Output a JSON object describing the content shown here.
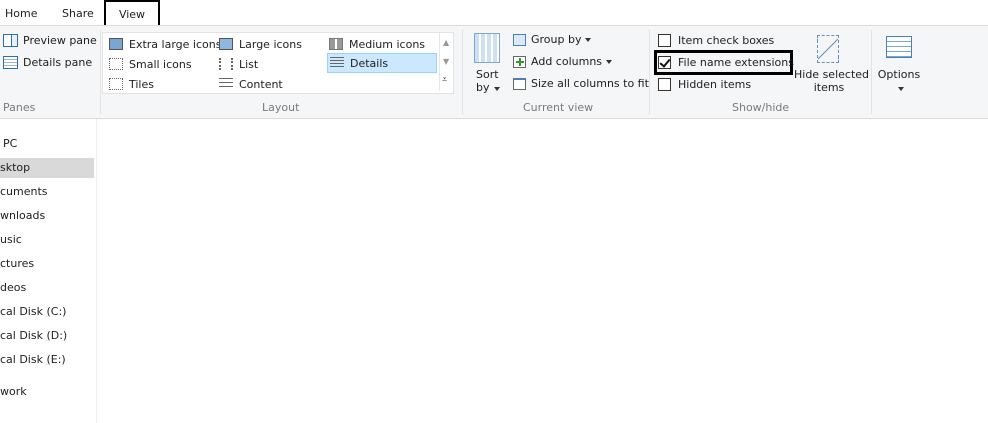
{
  "tabs": {
    "home": "Home",
    "share": "Share",
    "view": "View"
  },
  "panes": {
    "preview_pane": "Preview pane",
    "details_pane": "Details pane",
    "group_label": "Panes"
  },
  "layout": {
    "items": [
      "Extra large icons",
      "Large icons",
      "Medium icons",
      "Small icons",
      "List",
      "Details",
      "Tiles",
      "Content"
    ],
    "selected": "Details",
    "group_label": "Layout"
  },
  "current_view": {
    "sort_by_line1": "Sort",
    "sort_by_line2": "by",
    "group_by": "Group by",
    "add_columns": "Add columns",
    "size_all_columns": "Size all columns to fit",
    "group_label": "Current view"
  },
  "show_hide": {
    "item_check_boxes": "Item check boxes",
    "item_check_boxes_checked": false,
    "file_name_extensions": "File name extensions",
    "file_name_extensions_checked": true,
    "hidden_items": "Hidden items",
    "hidden_items_checked": false,
    "hide_selected_line1": "Hide selected",
    "hide_selected_line2": "items",
    "group_label": "Show/hide"
  },
  "options": {
    "label": "Options"
  },
  "nav": {
    "items": [
      "PC",
      "sktop",
      "cuments",
      "wnloads",
      "usic",
      "ctures",
      "deos",
      "cal Disk (C:)",
      "cal Disk (D:)",
      "cal Disk (E:)",
      "work"
    ],
    "selected": "sktop"
  },
  "colors": {
    "selection": "#cce8ff",
    "accent": "#0078d7",
    "nav_selected": "#d9d9d9"
  }
}
